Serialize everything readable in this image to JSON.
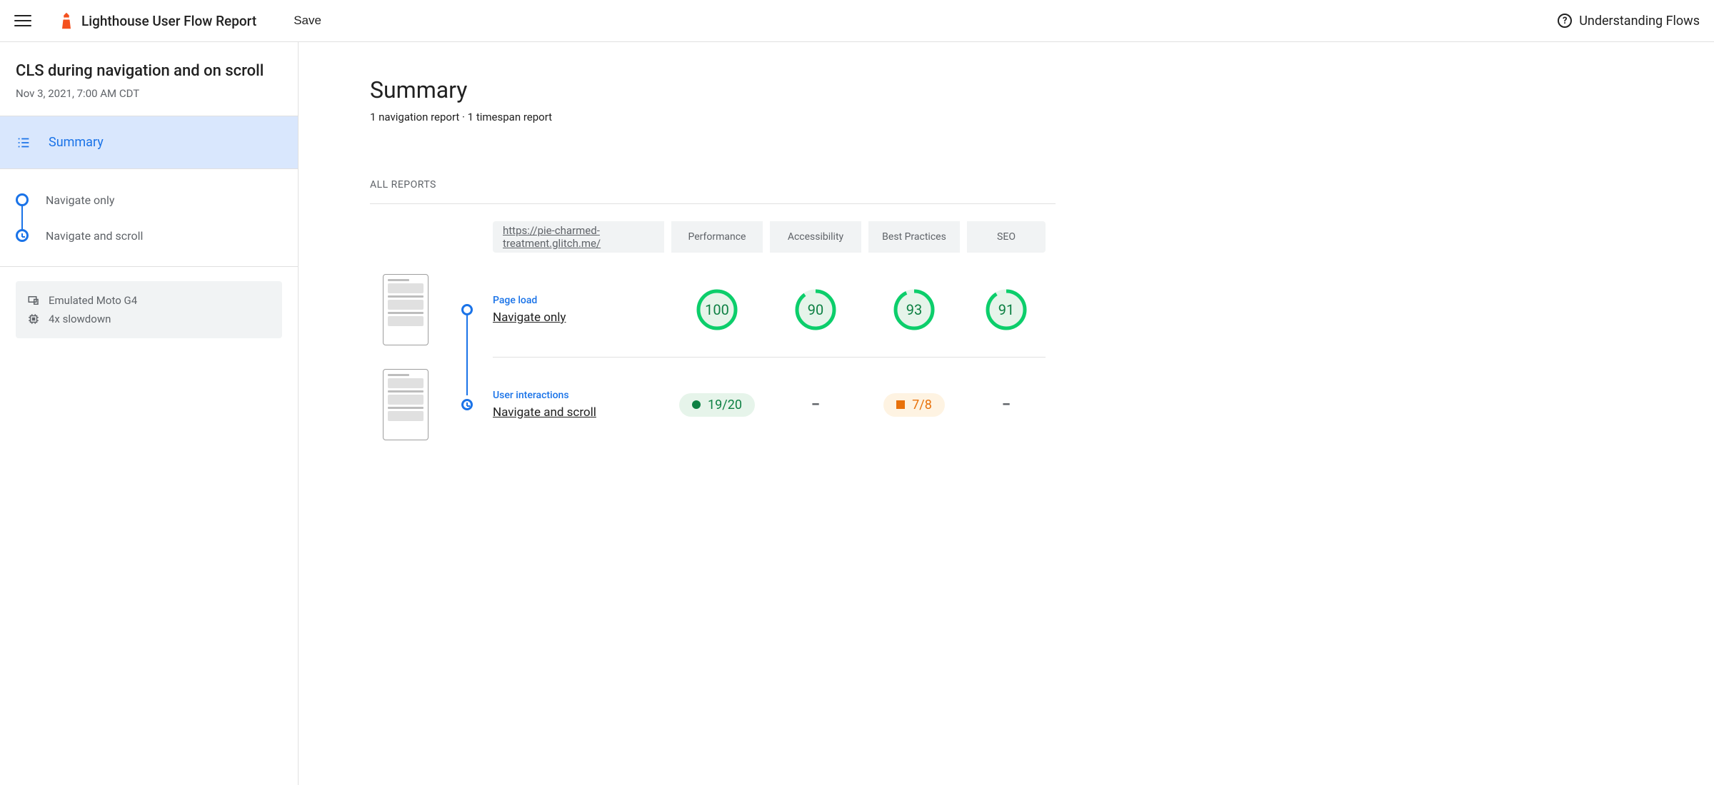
{
  "topbar": {
    "app_title": "Lighthouse User Flow Report",
    "save_label": "Save",
    "help_label": "Understanding Flows"
  },
  "sidebar": {
    "flow_title": "CLS during navigation and on scroll",
    "flow_date": "Nov 3, 2021, 7:00 AM CDT",
    "summary_label": "Summary",
    "steps": [
      {
        "label": "Navigate only",
        "type": "navigation"
      },
      {
        "label": "Navigate and scroll",
        "type": "timespan"
      }
    ],
    "env": {
      "device": "Emulated Moto G4",
      "throttle": "4x slowdown"
    }
  },
  "main": {
    "title": "Summary",
    "subtitle": "1 navigation report · 1 timespan report",
    "section_label": "ALL REPORTS",
    "columns": {
      "url": "https://pie-charmed-treatment.glitch.me/",
      "perf": "Performance",
      "a11y": "Accessibility",
      "bp": "Best Practices",
      "seo": "SEO"
    },
    "rows": [
      {
        "type_label": "Page load",
        "name": "Navigate only",
        "marker": "navigation",
        "scores": {
          "perf": 100,
          "a11y": 90,
          "bp": 93,
          "seo": 91
        }
      },
      {
        "type_label": "User interactions",
        "name": "Navigate and scroll",
        "marker": "timespan",
        "fractions": {
          "perf": "19/20",
          "bp": "7/8"
        }
      }
    ]
  },
  "colors": {
    "green": "#0cce6b",
    "green_light": "#e6f4ea",
    "orange": "#e8710a",
    "blue": "#1a73e8"
  }
}
